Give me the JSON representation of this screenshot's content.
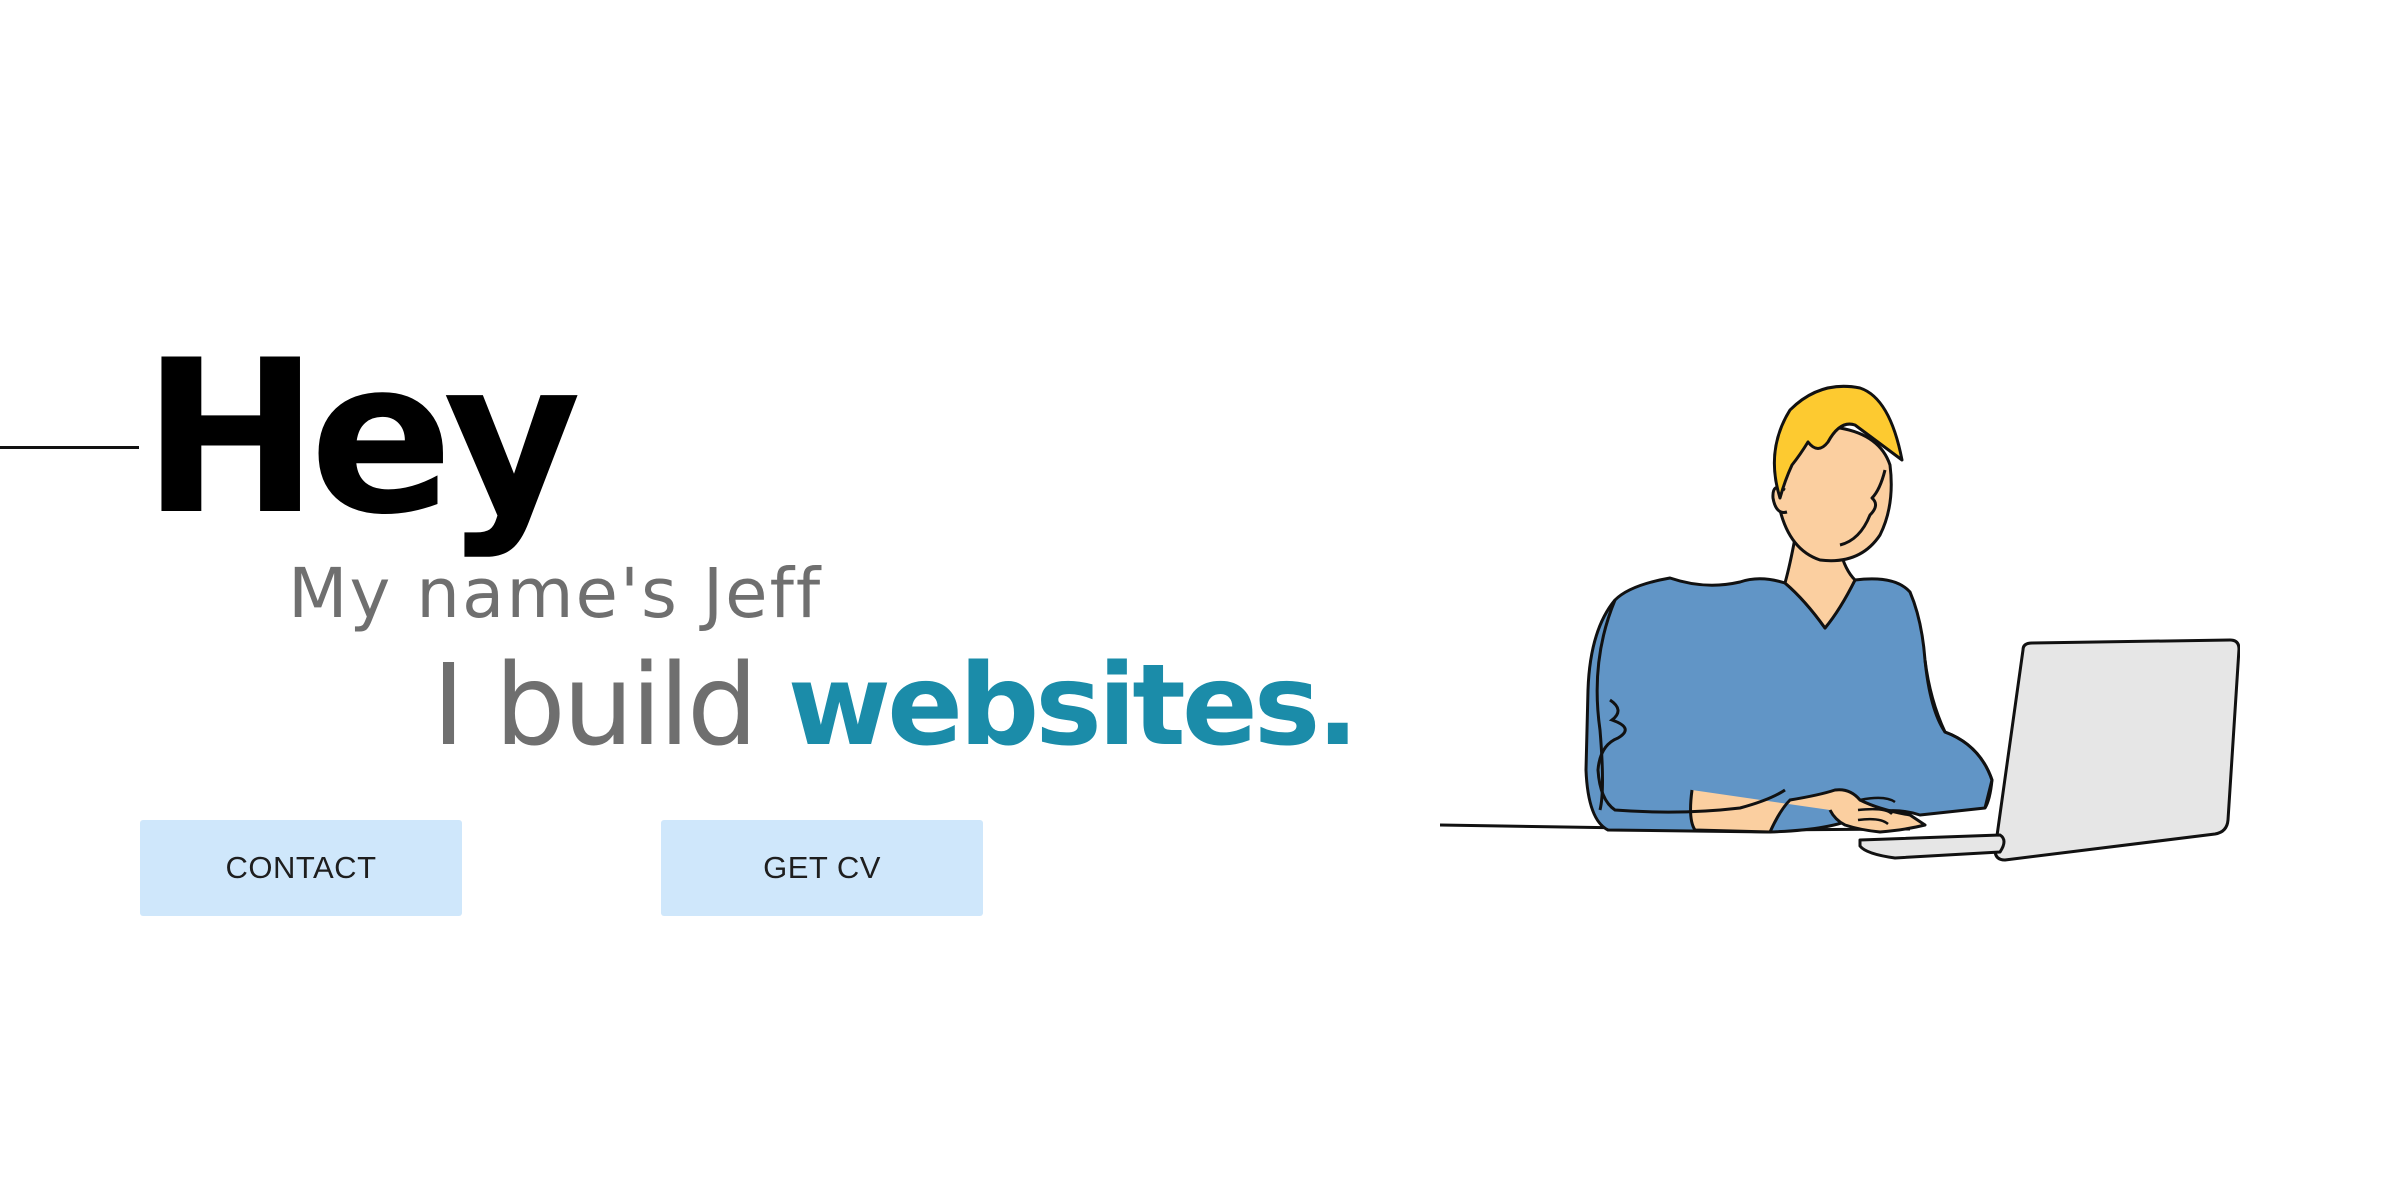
{
  "hero": {
    "greeting": "Hey",
    "intro": "My name's Jeff",
    "tagline_prefix": "I build ",
    "tagline_highlight": "websites."
  },
  "actions": {
    "contact_label": "CONTACT",
    "cv_label": "GET CV"
  },
  "colors": {
    "accent": "#1b8ca9",
    "button_bg": "#cfe7fb",
    "muted_text": "#6f6f6f",
    "shirt": "#6195c6",
    "hair": "#fdca30",
    "skin": "#fbcfa0",
    "laptop": "#e6e6e6"
  },
  "illustration": {
    "subject": "person-working-at-laptop"
  }
}
